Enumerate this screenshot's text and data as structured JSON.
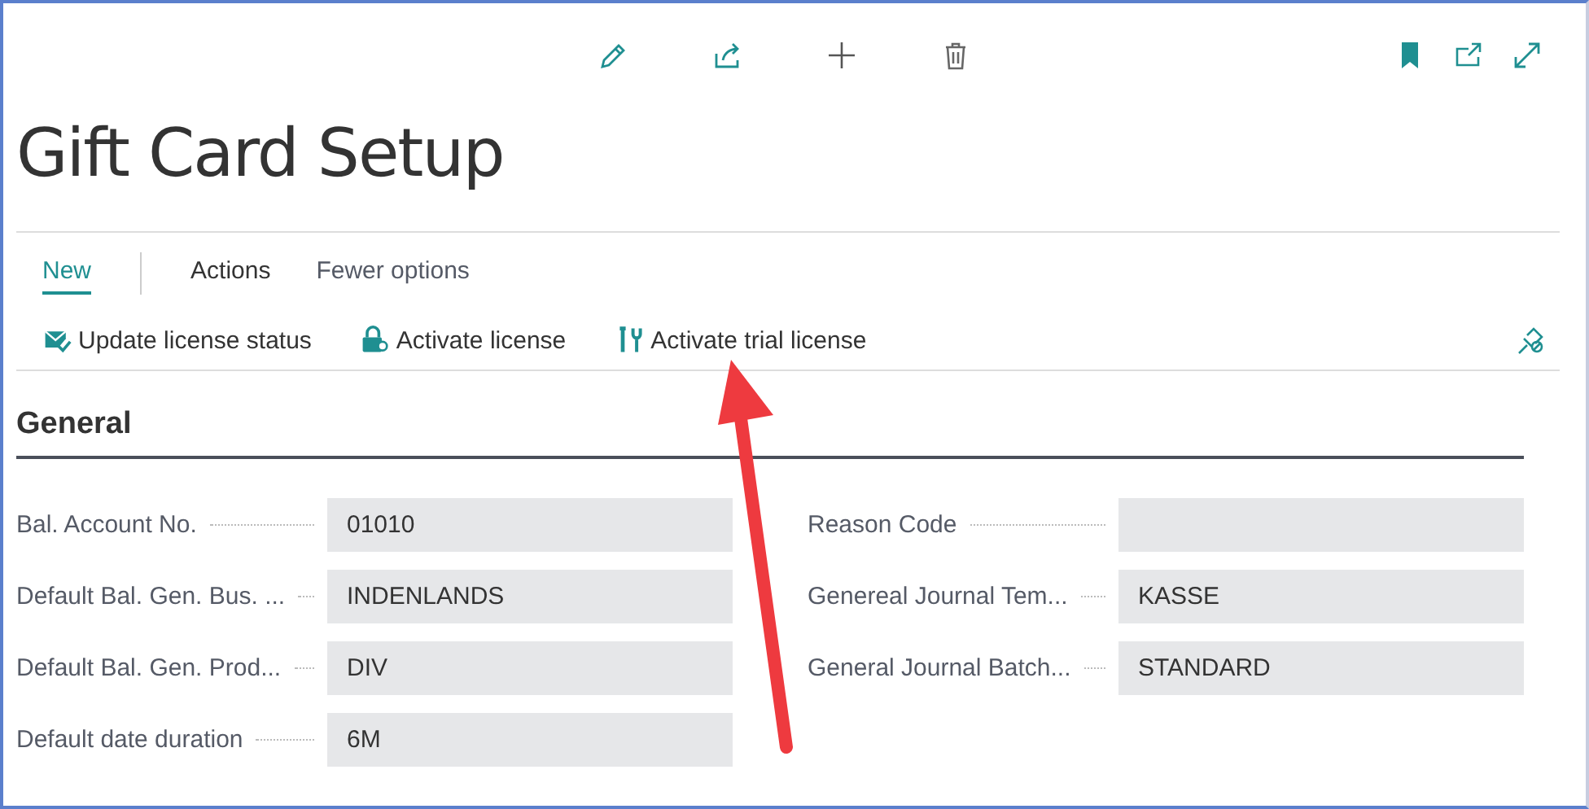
{
  "page": {
    "title": "Gift Card Setup"
  },
  "tabs": [
    {
      "label": "New",
      "selected": true
    },
    {
      "label": "Actions",
      "selected": false
    },
    {
      "label": "Fewer options",
      "selected": false
    }
  ],
  "actions": [
    {
      "label": "Update license status"
    },
    {
      "label": "Activate license"
    },
    {
      "label": "Activate trial license"
    }
  ],
  "section": {
    "title": "General",
    "left_fields": [
      {
        "label": "Bal. Account No.",
        "value": "01010"
      },
      {
        "label": "Default Bal. Gen. Bus. ...",
        "value": "INDENLANDS"
      },
      {
        "label": "Default Bal. Gen. Prod...",
        "value": "DIV"
      },
      {
        "label": "Default date duration",
        "value": "6M"
      }
    ],
    "right_fields": [
      {
        "label": "Reason Code"
      },
      {
        "label": "Genereal Journal Tem...",
        "value": "KASSE"
      },
      {
        "label": "General Journal Batch...",
        "value": "STANDARD"
      }
    ]
  }
}
